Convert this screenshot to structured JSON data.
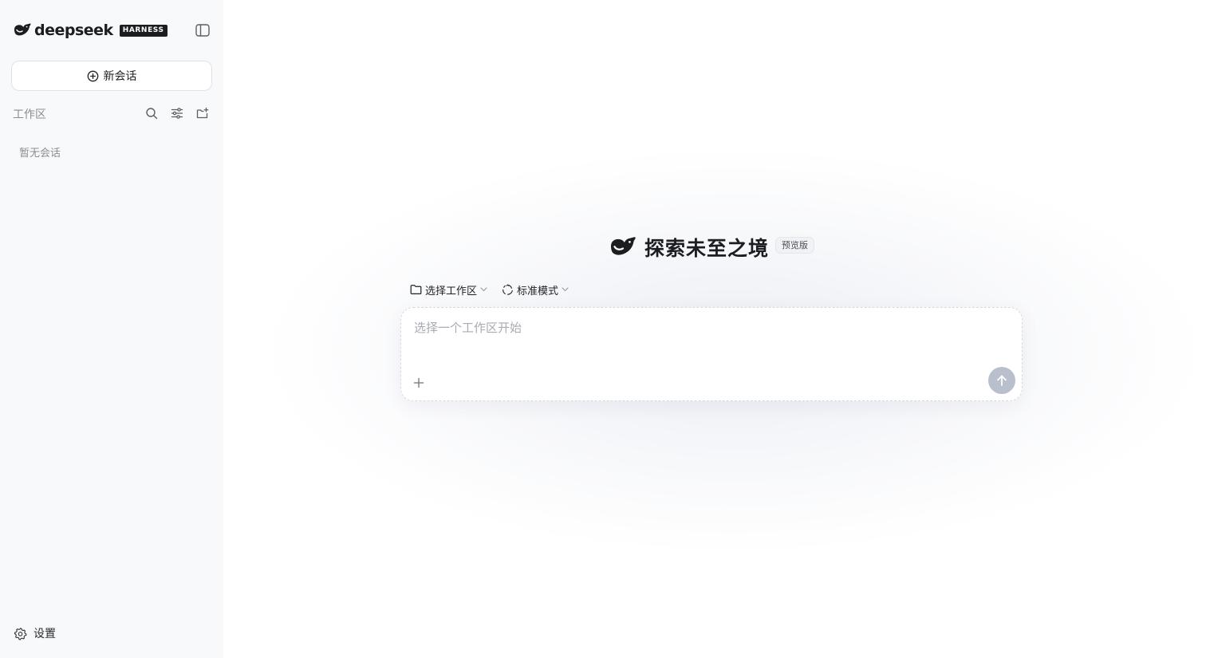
{
  "brand": {
    "name": "deepseek",
    "badge": "HARNESS",
    "logo_icon": "whale-logo-icon"
  },
  "sidebar": {
    "collapse_icon": "sidebar-toggle-icon",
    "new_chat": {
      "label": "新会话",
      "icon": "plus-circle-icon"
    },
    "workspace": {
      "title": "工作区",
      "actions": [
        {
          "name": "search",
          "icon": "search-icon"
        },
        {
          "name": "filter",
          "icon": "sliders-icon"
        },
        {
          "name": "new-folder",
          "icon": "folder-plus-icon"
        }
      ],
      "empty_text": "暂无会话"
    },
    "settings": {
      "label": "设置",
      "icon": "gear-icon"
    }
  },
  "main": {
    "hero": {
      "title": "探索未至之境",
      "badge": "预览版"
    },
    "toolbar": {
      "workspace_select": {
        "label": "选择工作区",
        "icon": "folder-icon"
      },
      "mode_select": {
        "label": "标准模式",
        "icon": "recycle-icon"
      }
    },
    "composer": {
      "placeholder": "选择一个工作区开始",
      "attach_icon": "plus-icon",
      "send_icon": "arrow-up-icon"
    }
  },
  "colors": {
    "sidebar_bg": "#f8f9fb",
    "send_button_disabled": "#b9bfcc",
    "muted_text": "#8a8d94",
    "brand_dark": "#1c1d20"
  }
}
